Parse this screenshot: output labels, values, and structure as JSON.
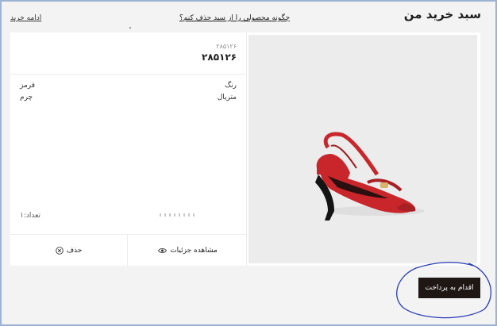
{
  "header": {
    "title": "سبد خرید من",
    "help_link": "چگونه محصولی را از سبد حذف کنم؟",
    "continue_link": "ادامه خرید"
  },
  "product": {
    "code_small": "۲۸۵۱۲۶",
    "code_large": "۲۸۵۱۲۶",
    "attributes": [
      {
        "label": "رنگ",
        "value": "قرمز"
      },
      {
        "label": "متریال",
        "value": "چرم"
      }
    ],
    "quantity_label": "تعداد:۱",
    "image_icon": "red-slingback-heel",
    "accent_color": "#c8262b"
  },
  "actions": {
    "details_label": "مشاهده جزئیات",
    "delete_label": "حذف"
  },
  "checkout": {
    "pay_label": "اقدام به پرداخت"
  }
}
